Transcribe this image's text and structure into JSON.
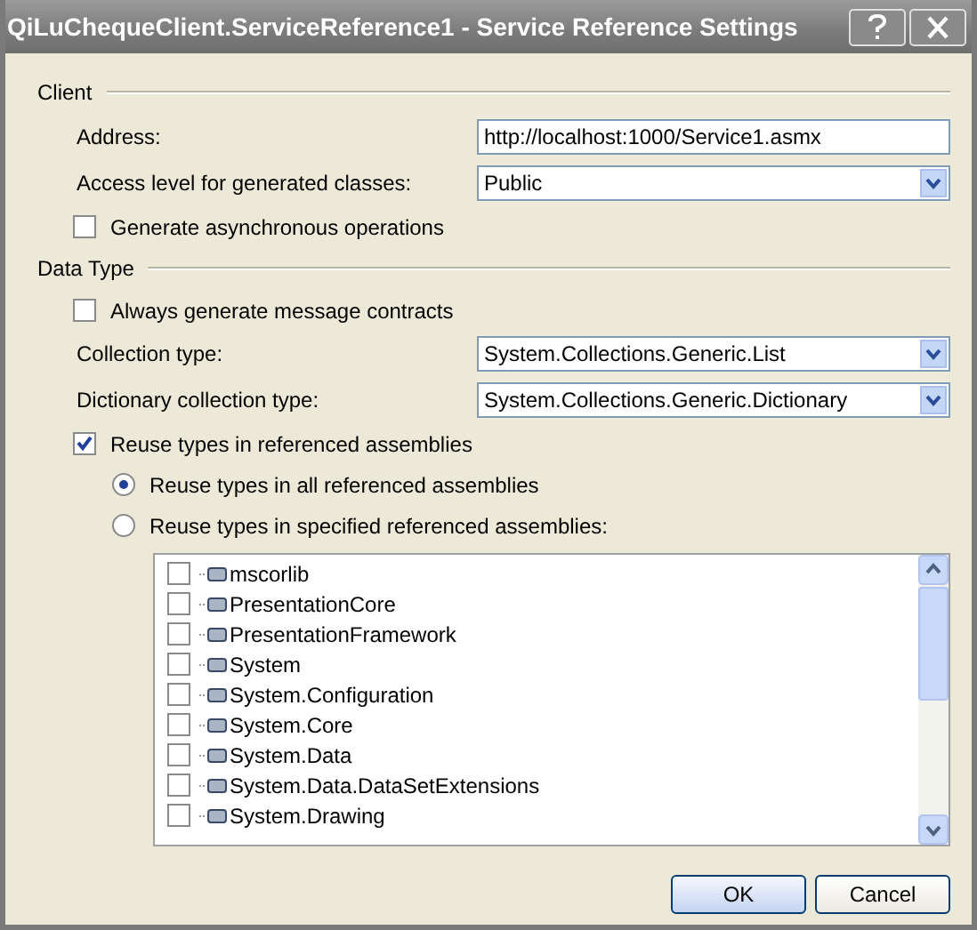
{
  "window": {
    "title": "QiLuChequeClient.ServiceReference1 - Service Reference Settings"
  },
  "sections": [
    {
      "title": "Client",
      "rows": [
        {
          "kind": "text",
          "label": "Address:",
          "value": "http://localhost:1000/Service1.asmx"
        },
        {
          "kind": "select",
          "label": "Access level for generated classes:",
          "value": "Public"
        },
        {
          "kind": "checkbox",
          "label": "Generate asynchronous operations",
          "checked": false
        }
      ]
    },
    {
      "title": "Data Type",
      "rows": [
        {
          "kind": "checkbox",
          "label": "Always generate message contracts",
          "checked": false
        },
        {
          "kind": "select",
          "label": "Collection type:",
          "value": "System.Collections.Generic.List"
        },
        {
          "kind": "select",
          "label": "Dictionary collection type:",
          "value": "System.Collections.Generic.Dictionary"
        },
        {
          "kind": "checkbox",
          "label": "Reuse types in referenced assemblies",
          "checked": true
        },
        {
          "kind": "radio",
          "label": "Reuse types in all referenced assemblies",
          "selected": true
        },
        {
          "kind": "radio",
          "label": "Reuse types in specified referenced assemblies:",
          "selected": false
        }
      ]
    }
  ],
  "assemblies": [
    {
      "name": "mscorlib",
      "checked": false
    },
    {
      "name": "PresentationCore",
      "checked": false
    },
    {
      "name": "PresentationFramework",
      "checked": false
    },
    {
      "name": "System",
      "checked": false
    },
    {
      "name": "System.Configuration",
      "checked": false
    },
    {
      "name": "System.Core",
      "checked": false
    },
    {
      "name": "System.Data",
      "checked": false
    },
    {
      "name": "System.Data.DataSetExtensions",
      "checked": false
    },
    {
      "name": "System.Drawing",
      "checked": false
    }
  ],
  "buttons": [
    "OK",
    "Cancel"
  ]
}
